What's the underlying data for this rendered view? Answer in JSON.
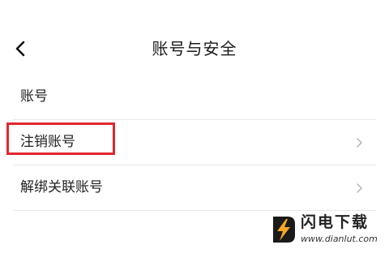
{
  "header": {
    "title": "账号与安全",
    "back_icon": "chevron-left-icon"
  },
  "list": {
    "items": [
      {
        "label": "账号",
        "has_chevron": false
      },
      {
        "label": "注销账号",
        "has_chevron": true,
        "highlighted": true
      },
      {
        "label": "解绑关联账号",
        "has_chevron": true
      }
    ]
  },
  "annotation": {
    "highlight_color": "#e0262e"
  },
  "watermark": {
    "title": "闪电下载",
    "url": "www.dianlut.com",
    "logo_colors": [
      "#f5a623",
      "#1a1a1a"
    ]
  }
}
